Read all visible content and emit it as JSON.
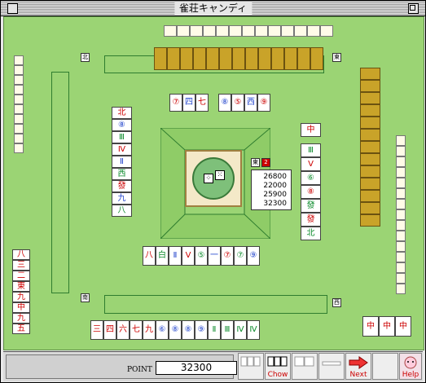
{
  "window": {
    "title": "雀荘キャンディ"
  },
  "seats": {
    "north": "北",
    "east": "東",
    "south": "南",
    "west": "西"
  },
  "round": {
    "wind_badge": "東",
    "round_number": "2"
  },
  "scores": [
    "26800",
    "22000",
    "25900",
    "32300"
  ],
  "status": {
    "point_label": "POINT",
    "point_value": "32300"
  },
  "toolbar": {
    "chow_label": "Chow",
    "next_label": "Next",
    "help_label": "Help"
  },
  "hand": {
    "tiles": [
      "三",
      "四",
      "六",
      "七",
      "九",
      "⑥",
      "⑧",
      "⑧",
      "⑨",
      "Ⅱ",
      "Ⅲ",
      "Ⅳ",
      "Ⅳ"
    ]
  },
  "player_melds": [
    "中",
    "中",
    "中"
  ],
  "colors": {
    "felt": "#9bd474",
    "tile_back": "#c9a329",
    "manzu": "#cc0000",
    "souzu": "#0a8a2a",
    "pinzu": "#2244cc"
  }
}
